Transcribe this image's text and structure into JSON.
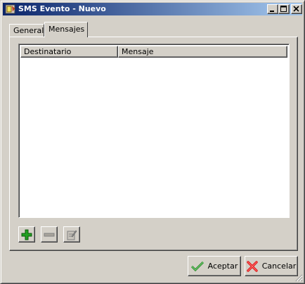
{
  "window": {
    "title": "SMS Evento - Nuevo",
    "icons": {
      "app": "app-icon",
      "minimize": "minimize-icon",
      "maximize": "maximize-icon",
      "close": "close-icon"
    }
  },
  "tabs": [
    {
      "label": "General",
      "selected": false
    },
    {
      "label": "Mensajes",
      "selected": true
    }
  ],
  "table": {
    "columns": [
      "Destinatario",
      "Mensaje"
    ],
    "rows": []
  },
  "toolbar": {
    "add_icon": "plus-icon",
    "remove_icon": "minus-icon",
    "edit_icon": "edit-icon"
  },
  "buttons": {
    "accept_label": "Aceptar",
    "cancel_label": "Cancelar"
  },
  "colors": {
    "titlebar_start": "#0a246a",
    "titlebar_end": "#a6caf0",
    "face": "#d4d0c8",
    "add_green": "#22a022",
    "cancel_red": "#e02020"
  }
}
